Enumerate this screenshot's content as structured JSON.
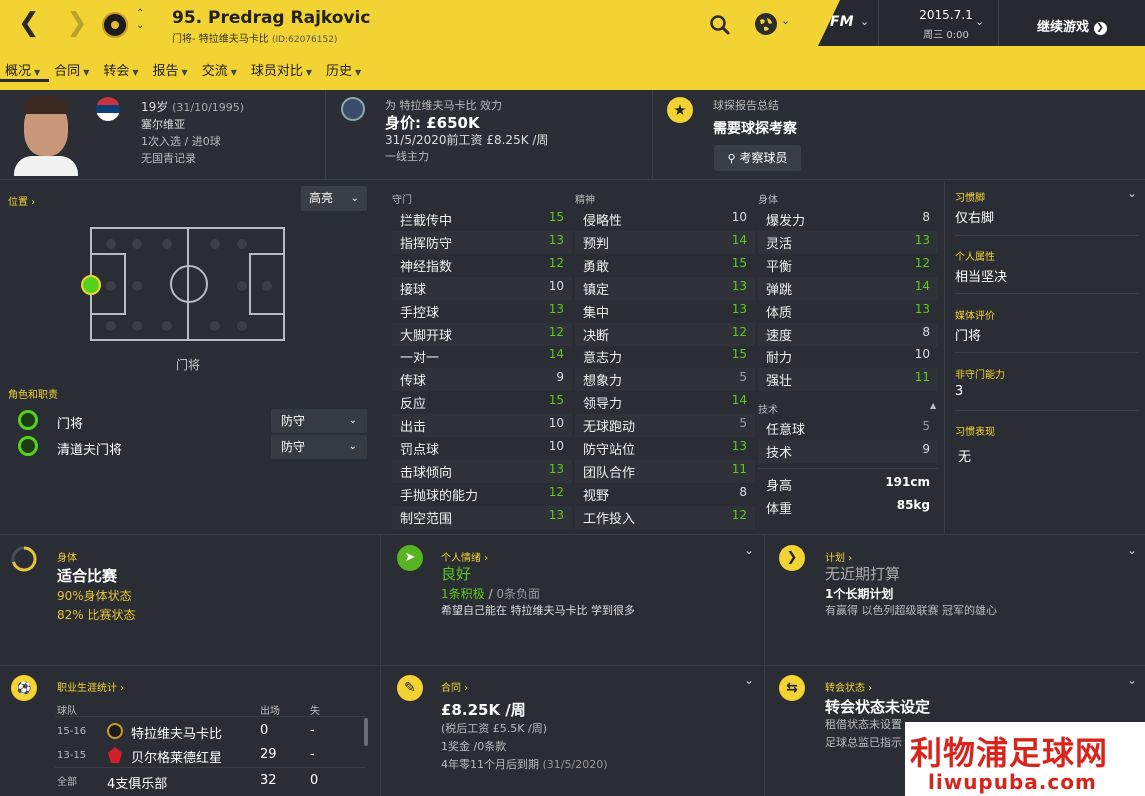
{
  "header": {
    "title": "95. Predrag Rajkovic",
    "subtitle": "门将- 特拉维夫马卡比",
    "subtitle_id": "(ID:62076152)",
    "date": "2015.7.1",
    "day": "周三 0:00",
    "fm": "FM",
    "continue": "继续游戏"
  },
  "menu": [
    "概况",
    "合同",
    "转会",
    "报告",
    "交流",
    "球员对比",
    "历史"
  ],
  "info": {
    "age": "19岁",
    "dob": "(31/10/1995)",
    "nation": "塞尔维亚",
    "caps": "1次入选 / 进0球",
    "youth": "无国青记录",
    "club_line": "为 特拉维夫马卡比 效力",
    "value": "身价: £650K",
    "wage": "31/5/2020前工资 £8.25K /周",
    "status": "一线主力",
    "scout_title": "球探报告总结",
    "scout_need": "需要球探考察",
    "scout_btn": "考察球员"
  },
  "position": {
    "label": "位置",
    "highlight": "高亮",
    "pos_name": "门将",
    "roles_label": "角色和职责",
    "roles": [
      {
        "name": "门将",
        "duty": "防守"
      },
      {
        "name": "清道夫门将",
        "duty": "防守"
      }
    ]
  },
  "attributes": {
    "gk_header": "守门",
    "mental_header": "精神",
    "physical_header": "身体",
    "tech_header": "技术",
    "gk": [
      [
        "拦截传中",
        "15"
      ],
      [
        "指挥防守",
        "13"
      ],
      [
        "神经指数",
        "12"
      ],
      [
        "接球",
        "10"
      ],
      [
        "手控球",
        "13"
      ],
      [
        "大脚开球",
        "12"
      ],
      [
        "一对一",
        "14"
      ],
      [
        "传球",
        "9"
      ],
      [
        "反应",
        "15"
      ],
      [
        "出击",
        "10"
      ],
      [
        "罚点球",
        "10"
      ],
      [
        "击球倾向",
        "13"
      ],
      [
        "手抛球的能力",
        "12"
      ],
      [
        "制空范围",
        "13"
      ]
    ],
    "mental": [
      [
        "侵略性",
        "10"
      ],
      [
        "预判",
        "14"
      ],
      [
        "勇敢",
        "15"
      ],
      [
        "镇定",
        "13"
      ],
      [
        "集中",
        "13"
      ],
      [
        "决断",
        "12"
      ],
      [
        "意志力",
        "15"
      ],
      [
        "想象力",
        "5"
      ],
      [
        "领导力",
        "14"
      ],
      [
        "无球跑动",
        "5"
      ],
      [
        "防守站位",
        "13"
      ],
      [
        "团队合作",
        "11"
      ],
      [
        "视野",
        "8"
      ],
      [
        "工作投入",
        "12"
      ]
    ],
    "physical": [
      [
        "爆发力",
        "8"
      ],
      [
        "灵活",
        "13"
      ],
      [
        "平衡",
        "12"
      ],
      [
        "弹跳",
        "14"
      ],
      [
        "体质",
        "13"
      ],
      [
        "速度",
        "8"
      ],
      [
        "耐力",
        "10"
      ],
      [
        "强壮",
        "11"
      ]
    ],
    "tech": [
      [
        "任意球",
        "5"
      ],
      [
        "技术",
        "9"
      ]
    ],
    "height_label": "身高",
    "height": "191cm",
    "weight_label": "体重",
    "weight": "85kg"
  },
  "side": {
    "foot_label": "习惯脚",
    "foot": "仅右脚",
    "pers_label": "个人属性",
    "pers": "相当坚决",
    "media_label": "媒体评价",
    "media": "门将",
    "ngk_label": "非守门能力",
    "ngk": "3",
    "hab_label": "习惯表现",
    "hab": "无"
  },
  "cards": {
    "phys_title": "身体",
    "phys_big": "适合比赛",
    "phys_l1": "90%身体状态",
    "phys_l2": "82% 比赛状态",
    "mood_title": "个人情绪",
    "mood_big": "良好",
    "mood_pos": "1条积极",
    "mood_slash": "/",
    "mood_neg": "0条负面",
    "mood_desc": "希望自己能在 特拉维夫马卡比 学到很多",
    "plan_title": "计划",
    "plan_big": "无近期打算",
    "plan_sub": "1个长期计划",
    "plan_desc": "有赢得 以色列超级联赛 冠军的雄心",
    "career_title": "职业生涯统计",
    "col_club": "球队",
    "col_apps": "出场",
    "col_gc": "失",
    "career": [
      {
        "year": "15-16",
        "club": "特拉维夫马卡比",
        "apps": "0",
        "gc": "-"
      },
      {
        "year": "13-15",
        "club": "贝尔格莱德红星",
        "apps": "29",
        "gc": "-"
      },
      {
        "year": "全部",
        "club": "4支俱乐部",
        "apps": "32",
        "gc": "0"
      }
    ],
    "contract_title": "合同",
    "contract_big": "£8.25K /周",
    "contract_l1": "(税后工资 £5.5K /周)",
    "contract_l2": "1奖金 /0条款",
    "contract_l3": "4年零11个月后到期",
    "contract_l3b": "(31/5/2020)",
    "transfer_title": "转会状态",
    "transfer_big": "转会状态未设定",
    "transfer_l1": "租借状态未设置",
    "transfer_l2": "足球总监已指示"
  },
  "watermark": {
    "cn": "利物浦足球网",
    "url": "liwupuba.com"
  }
}
